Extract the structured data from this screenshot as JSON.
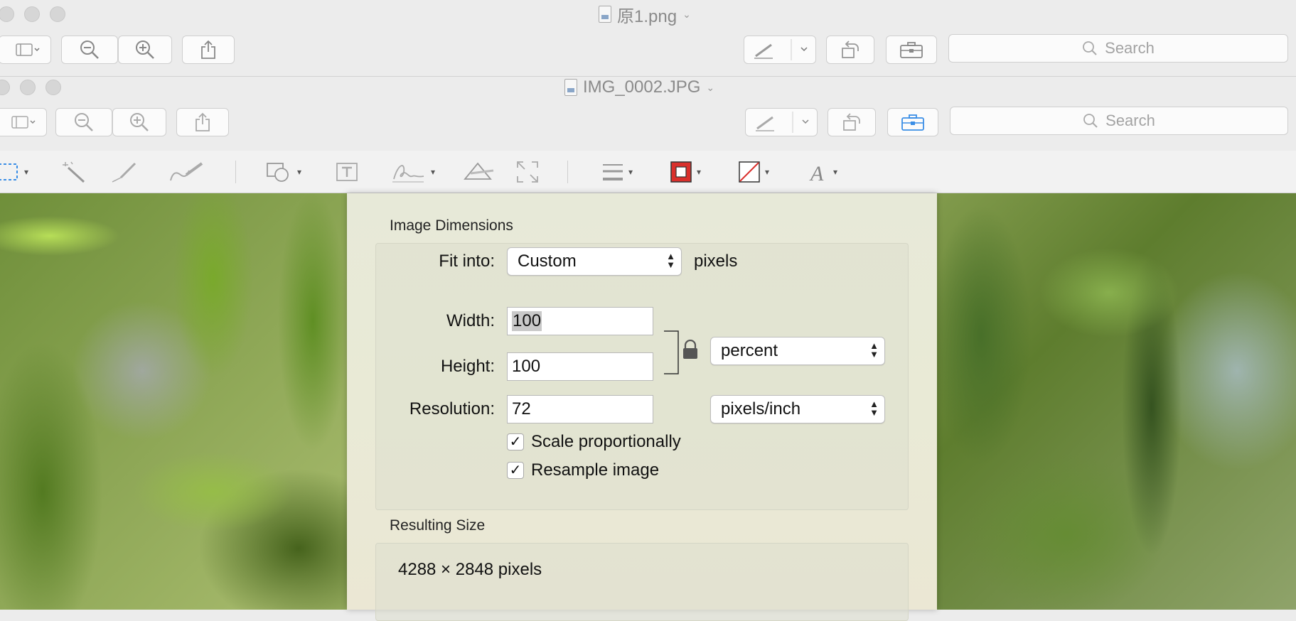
{
  "window_back": {
    "title": "原1.png",
    "search_placeholder": "Search"
  },
  "window_front": {
    "title": "IMG_0002.JPG",
    "search_placeholder": "Search"
  },
  "dialog": {
    "image_dimensions_label": "Image Dimensions",
    "fit_into_label": "Fit into:",
    "fit_into_value": "Custom",
    "fit_into_unit": "pixels",
    "width_label": "Width:",
    "width_value": "100",
    "height_label": "Height:",
    "height_value": "100",
    "size_unit": "percent",
    "resolution_label": "Resolution:",
    "resolution_value": "72",
    "resolution_unit": "pixels/inch",
    "scale_label": "Scale proportionally",
    "scale_checked": true,
    "resample_label": "Resample image",
    "resample_checked": true,
    "resulting_size_label": "Resulting Size",
    "resulting_size_value": "4288 × 2848 pixels"
  },
  "icons": [
    "sidebar-icon",
    "zoom-out-icon",
    "zoom-in-icon",
    "share-icon",
    "markup-pen-icon",
    "rotate-icon",
    "toolbox-icon",
    "search-icon",
    "rect-select-icon",
    "magic-wand-icon",
    "sketch-icon",
    "draw-icon",
    "shapes-icon",
    "text-box-icon",
    "signature-icon",
    "adjust-color-icon",
    "adjust-size-icon",
    "line-style-icon",
    "border-color-icon",
    "fill-color-icon",
    "text-style-icon",
    "lock-icon"
  ],
  "colors": {
    "accent_blue": "#3a8ee6",
    "border_red": "#d9302c"
  }
}
